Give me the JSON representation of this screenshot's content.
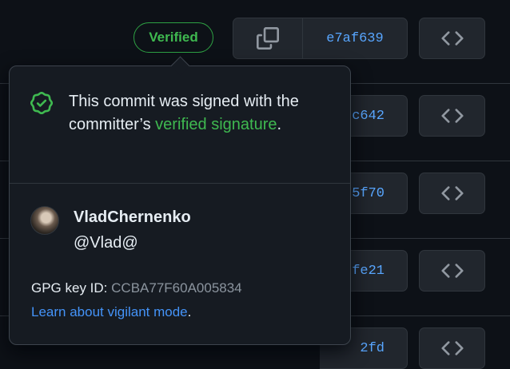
{
  "header_row": {
    "badge_label": "Verified",
    "sha": "e7af639"
  },
  "rows": [
    {
      "sha_fragment": "c642"
    },
    {
      "sha_fragment": "5f70"
    },
    {
      "sha_fragment": "fe21"
    },
    {
      "sha_fragment": "2fd"
    }
  ],
  "icons": {
    "copy": "copy-icon",
    "code": "code-icon",
    "verified": "verified-check-icon"
  },
  "popover": {
    "text_before": "This commit was signed with the committer’s ",
    "text_link": "verified signature",
    "text_after": ".",
    "user_name": "VladChernenko",
    "user_handle": "@Vlad@",
    "gpg_label": "GPG key ID: ",
    "gpg_key": "CCBA77F60A005834",
    "learn_link": "Learn about vigilant mode",
    "learn_after": "."
  },
  "colors": {
    "accent_green": "#3fb950",
    "link_blue": "#58a6ff",
    "background": "#0d1117"
  }
}
